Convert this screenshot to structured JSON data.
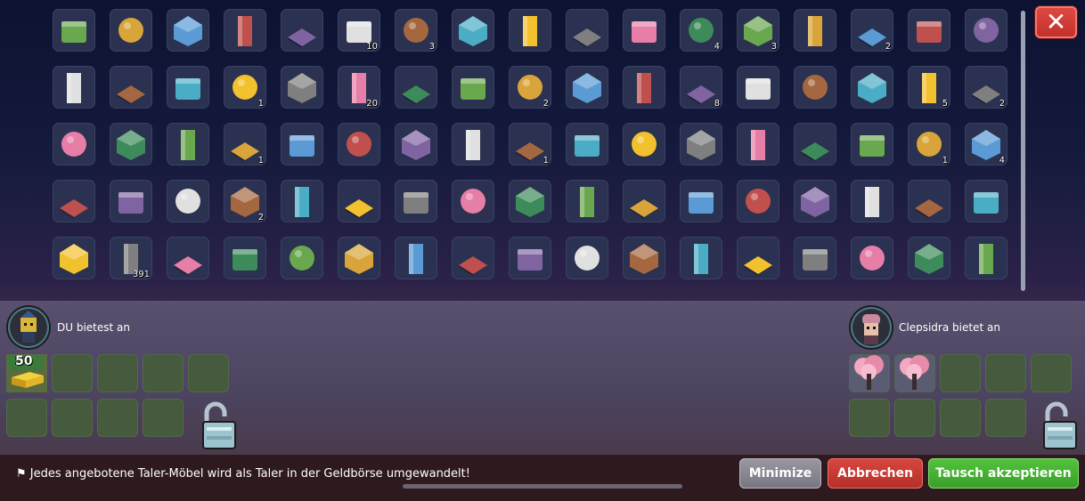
{
  "inventory": {
    "rows": [
      [
        {
          "icon": "credit-50-icon",
          "count": ""
        },
        {
          "icon": "bottle-icon",
          "count": ""
        },
        {
          "icon": "clock-sign-icon",
          "count": ""
        },
        {
          "icon": "keyboard-icon",
          "count": ""
        },
        {
          "icon": "white-panel-icon",
          "count": ""
        },
        {
          "icon": "planter-icon",
          "count": "10"
        },
        {
          "icon": "grass-block-icon",
          "count": "3"
        },
        {
          "icon": "yellow-bed-icon",
          "count": ""
        },
        {
          "icon": "red-cabinet-icon",
          "count": ""
        },
        {
          "icon": "rock-icon",
          "count": ""
        },
        {
          "icon": "dark-box-icon",
          "count": ""
        },
        {
          "icon": "red-rug-icon",
          "count": "4"
        },
        {
          "icon": "stool-icon",
          "count": "3"
        },
        {
          "icon": "rainbow-tile-icon",
          "count": ""
        },
        {
          "icon": "table-icon",
          "count": "2"
        },
        {
          "icon": "glass-corner-icon",
          "count": ""
        },
        {
          "icon": "guitar-icon",
          "count": ""
        }
      ],
      [
        {
          "icon": "machine-icon",
          "count": ""
        },
        {
          "icon": "cane-icon",
          "count": ""
        },
        {
          "icon": "hanger-icon",
          "count": ""
        },
        {
          "icon": "tree-icon",
          "count": "1"
        },
        {
          "icon": "purple-flower-icon",
          "count": ""
        },
        {
          "icon": "duck-icon",
          "count": "20"
        },
        {
          "icon": "orange-boat-icon",
          "count": ""
        },
        {
          "icon": "frame-icon",
          "count": ""
        },
        {
          "icon": "grey-panel-icon",
          "count": "2"
        },
        {
          "icon": "plant-icon",
          "count": ""
        },
        {
          "icon": "bonsai-icon",
          "count": ""
        },
        {
          "icon": "dark-tile-icon",
          "count": "8"
        },
        {
          "icon": "golden-throne-icon",
          "count": ""
        },
        {
          "icon": "glass-panel-icon",
          "count": ""
        },
        {
          "icon": "door-icon",
          "count": ""
        },
        {
          "icon": "dice-icon",
          "count": "5"
        },
        {
          "icon": "microphone-icon",
          "count": "2"
        }
      ],
      [
        {
          "icon": "wooden-tray-icon",
          "count": ""
        },
        {
          "icon": "green-stack-icon",
          "count": ""
        },
        {
          "icon": "donut-icon",
          "count": ""
        },
        {
          "icon": "pillar-icon",
          "count": "1"
        },
        {
          "icon": "blue-tile-icon",
          "count": ""
        },
        {
          "icon": "flower-box-icon",
          "count": ""
        },
        {
          "icon": "log-icon",
          "count": ""
        },
        {
          "icon": "yellow-pad-icon",
          "count": ""
        },
        {
          "icon": "pirate-flag-icon",
          "count": "1"
        },
        {
          "icon": "pink-cushion-icon",
          "count": ""
        },
        {
          "icon": "gift-box-icon",
          "count": ""
        },
        {
          "icon": "cake-icon",
          "count": ""
        },
        {
          "icon": "orange-cylinder-icon",
          "count": ""
        },
        {
          "icon": "pink-cylinder-icon",
          "count": ""
        },
        {
          "icon": "pipe-icon",
          "count": ""
        },
        {
          "icon": "scoreboard-icon",
          "count": "1"
        },
        {
          "icon": "side-table-icon",
          "count": "4"
        }
      ],
      [
        {
          "icon": "bonsai-tree-icon",
          "count": ""
        },
        {
          "icon": "ice-cave-icon",
          "count": ""
        },
        {
          "icon": "barrel-icon",
          "count": ""
        },
        {
          "icon": "ice-creature-icon",
          "count": "2"
        },
        {
          "icon": "tree-stump-icon",
          "count": ""
        },
        {
          "icon": "ice-block-icon",
          "count": ""
        },
        {
          "icon": "lamp-post-icon",
          "count": ""
        },
        {
          "icon": "eskimo-icon",
          "count": ""
        },
        {
          "icon": "potion-icon",
          "count": ""
        },
        {
          "icon": "bear-icon",
          "count": ""
        },
        {
          "icon": "pudding-icon",
          "count": ""
        },
        {
          "icon": "deer-icon",
          "count": ""
        },
        {
          "icon": "harp-icon",
          "count": ""
        },
        {
          "icon": "blue-wizard-icon",
          "count": ""
        },
        {
          "icon": "ice-queen-icon",
          "count": ""
        },
        {
          "icon": "penguin-icon",
          "count": ""
        },
        {
          "icon": "purple-donut-icon",
          "count": ""
        }
      ],
      [
        {
          "icon": "aquarium-icon",
          "count": ""
        },
        {
          "icon": "green-bush-icon",
          "count": "391"
        },
        {
          "icon": "fridge-icon",
          "count": ""
        },
        {
          "icon": "wardrobe-icon",
          "count": ""
        },
        {
          "icon": "gold-bars-icon",
          "count": ""
        },
        {
          "icon": "ice-stairs-icon",
          "count": ""
        },
        {
          "icon": "wooden-tub-icon",
          "count": ""
        },
        {
          "icon": "cactus-icon",
          "count": ""
        },
        {
          "icon": "crab-icon",
          "count": ""
        },
        {
          "icon": "crystal-icon",
          "count": ""
        },
        {
          "icon": "fox-icon",
          "count": ""
        },
        {
          "icon": "tank-icon",
          "count": ""
        },
        {
          "icon": "seat-icon",
          "count": ""
        },
        {
          "icon": "clownfish-icon",
          "count": ""
        },
        {
          "icon": "pastry-icon",
          "count": ""
        },
        {
          "icon": "fish-icon",
          "count": ""
        },
        {
          "icon": "surfboard-icon",
          "count": ""
        }
      ]
    ]
  },
  "trade": {
    "my_label": "DU bietest an",
    "my_avatar": "user-avatar-icon",
    "my_items": [
      {
        "icon": "gold-credit-icon",
        "count": "50"
      }
    ],
    "other_label": "Clepsidra bietet an",
    "other_avatar": "clepsidra-avatar-icon",
    "other_items": [
      {
        "icon": "cherry-tree-icon",
        "count": ""
      },
      {
        "icon": "cherry-tree-icon",
        "count": ""
      }
    ]
  },
  "footer": {
    "notice": "Jedes angebotene Taler-Möbel wird als Taler in der Geldbörse umgewandelt!",
    "minimize": "Minimize",
    "cancel": "Abbrechen",
    "accept": "Tausch akzeptieren"
  },
  "colors": {
    "cancel": "#c8392f",
    "accept": "#45b332",
    "minimize": "#8a8892",
    "close": "#d63c36"
  }
}
